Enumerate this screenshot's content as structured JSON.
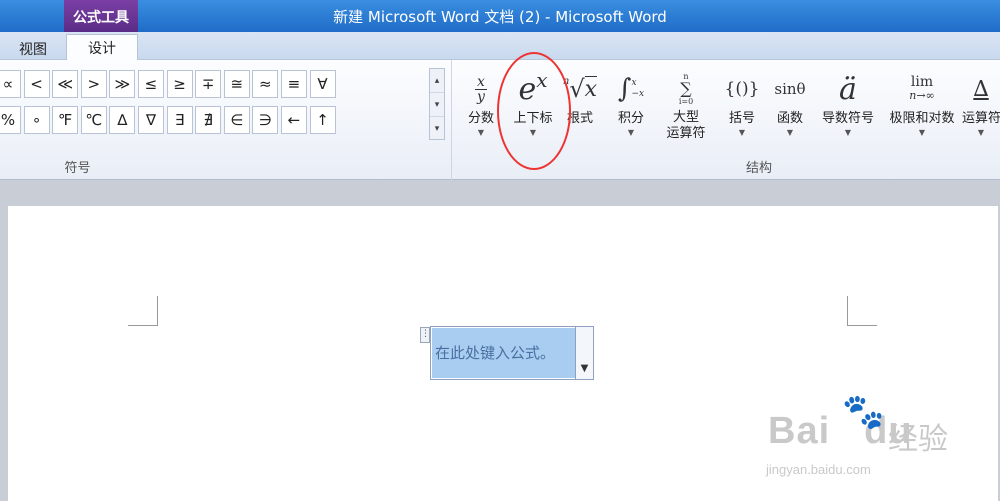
{
  "window": {
    "title": "新建 Microsoft Word 文档 (2) - Microsoft Word",
    "context_tab": "公式工具"
  },
  "tabs": [
    {
      "label": "视图"
    },
    {
      "label": "设计"
    }
  ],
  "symbols": {
    "group_label": "符号",
    "row1": [
      "∝",
      "<",
      "≪",
      ">",
      "≫",
      "≤",
      "≥",
      "∓",
      "≅",
      "≈",
      "≡",
      "∀"
    ],
    "row2": [
      "%",
      "∘",
      "℉",
      "℃",
      "∆",
      "∇",
      "∃",
      "∄",
      "∈",
      "∋",
      "←",
      "↑"
    ]
  },
  "structures": {
    "group_label": "结构",
    "items": [
      {
        "label": "分数",
        "icon": "fraction-icon"
      },
      {
        "label": "上下标",
        "icon": "script-icon"
      },
      {
        "label": "根式",
        "icon": "radical-icon"
      },
      {
        "label": "积分",
        "icon": "integral-icon"
      },
      {
        "label": "大型\n运算符",
        "icon": "large-operator-icon"
      },
      {
        "label": "括号",
        "icon": "bracket-icon"
      },
      {
        "label": "函数",
        "icon": "function-icon"
      },
      {
        "label": "导数符号",
        "icon": "accent-icon"
      },
      {
        "label": "极限和对数",
        "icon": "limit-icon"
      },
      {
        "label": "运算符",
        "icon": "operator-icon"
      }
    ]
  },
  "document": {
    "equation_placeholder": "在此处键入公式。"
  },
  "watermark": {
    "brand": "Bai",
    "brand_suffix": "du",
    "cn": "经验",
    "url": "jingyan.baidu.com"
  },
  "colors": {
    "highlight_circle": "#e33333",
    "equation_selection": "#a8cdf1",
    "context_tab": "#6a3596"
  }
}
